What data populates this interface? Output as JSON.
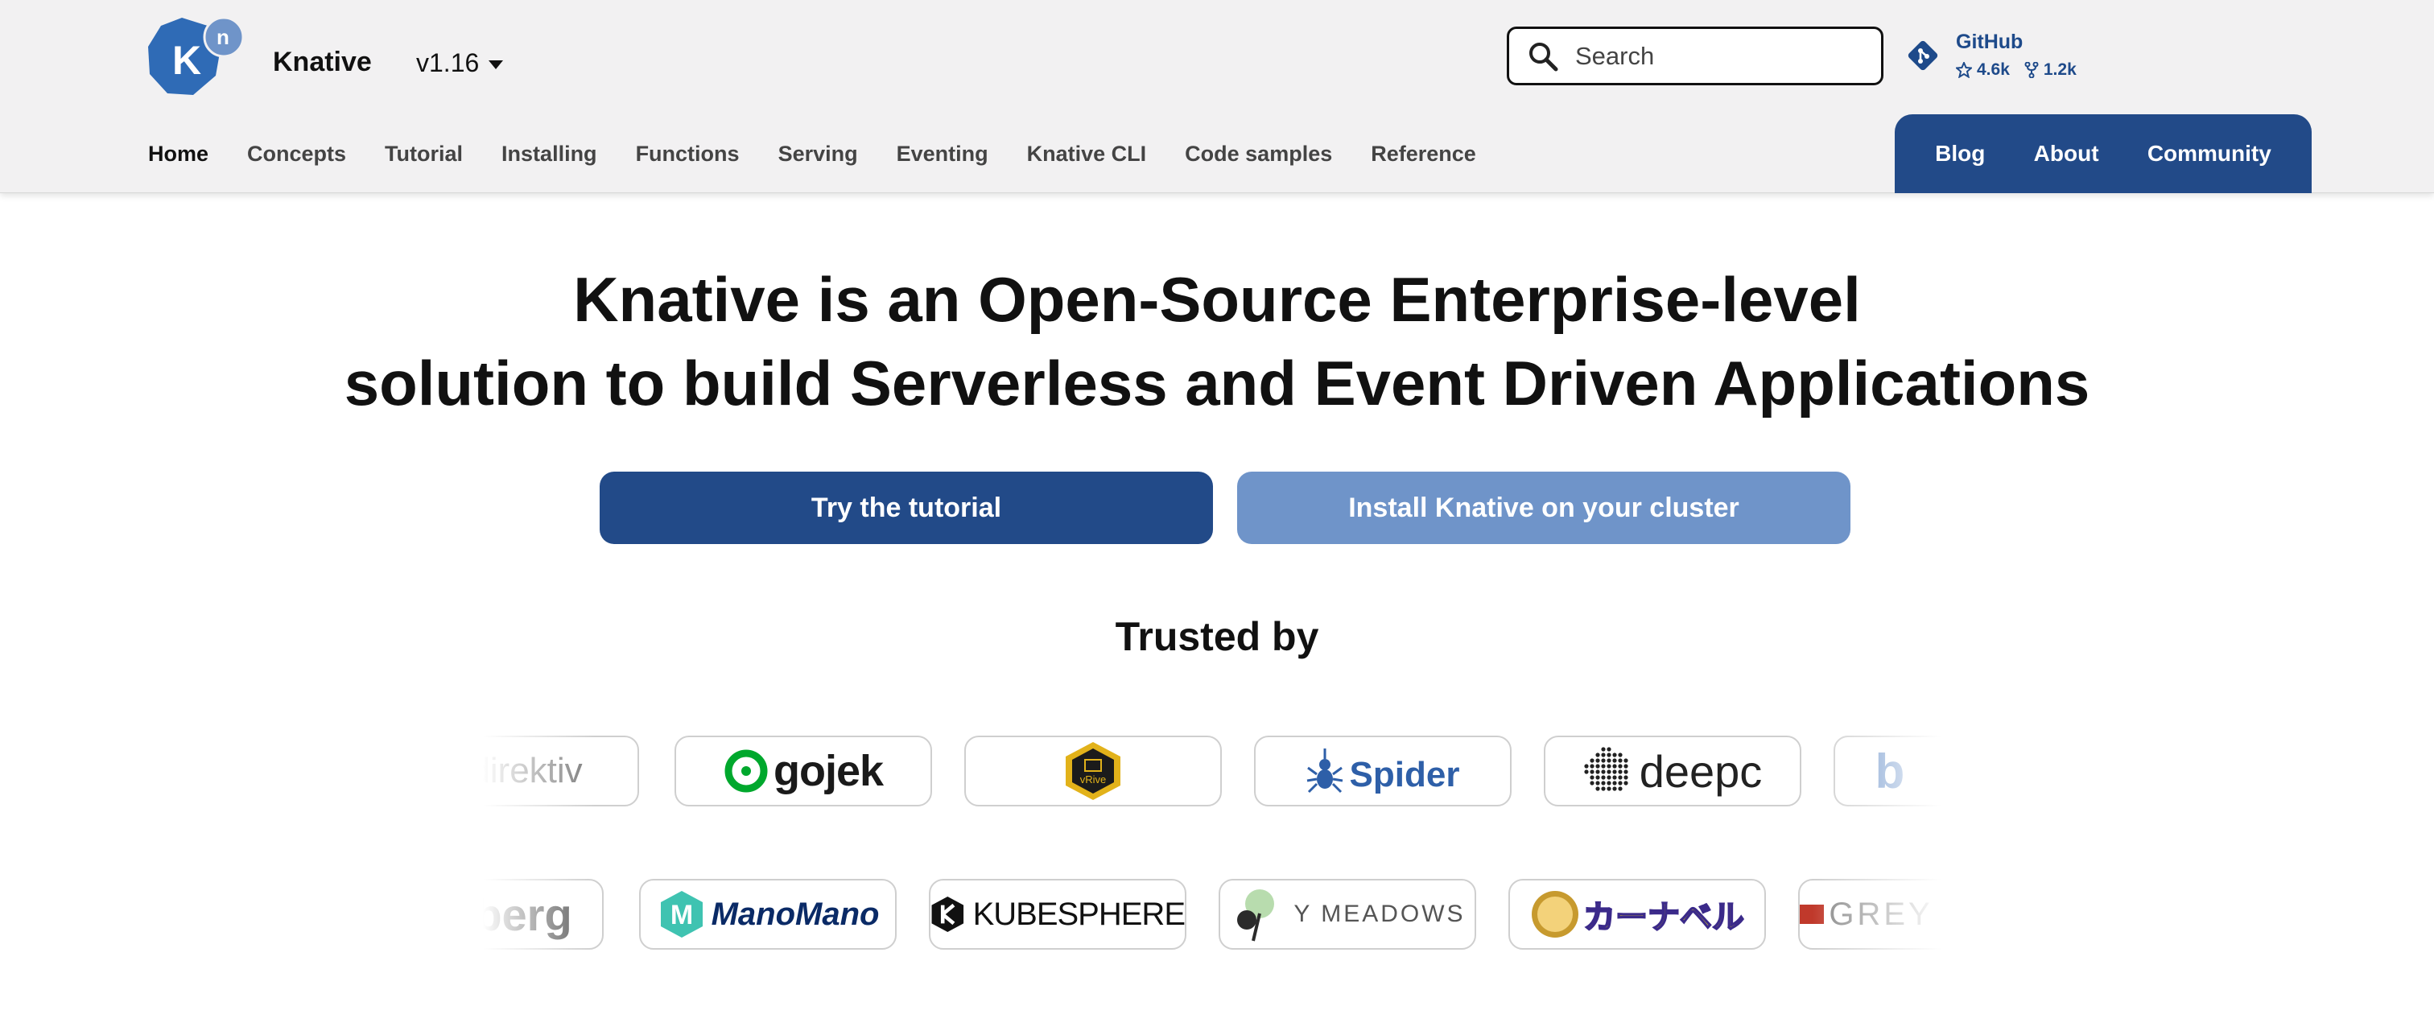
{
  "header": {
    "brand": "Knative",
    "logo_letter": "K",
    "logo_badge": "n",
    "version": "v1.16",
    "search_placeholder": "Search",
    "github": {
      "label": "GitHub",
      "stars": "4.6k",
      "forks": "1.2k"
    },
    "nav": [
      "Home",
      "Concepts",
      "Tutorial",
      "Installing",
      "Functions",
      "Serving",
      "Eventing",
      "Knative CLI",
      "Code samples",
      "Reference"
    ],
    "nav_active": "Home",
    "nav_right": [
      "Blog",
      "About",
      "Community"
    ]
  },
  "hero": {
    "title_line1": "Knative is an Open-Source Enterprise-level",
    "title_line2": "solution to build Serverless and Event Driven Applications",
    "primary_button": "Try the tutorial",
    "secondary_button": "Install Knative on your cluster"
  },
  "trusted": {
    "heading": "Trusted by",
    "row1": [
      "direktiv",
      "gojek",
      "vRive",
      "Spider",
      "deepc",
      "b"
    ],
    "row2": [
      "berg",
      "ManoMano",
      "KUBESPHERE",
      "Y MEADOWS",
      "カーナベル",
      "GREY"
    ]
  },
  "colors": {
    "brand_blue": "#224a88",
    "light_blue": "#6f94c9",
    "logo_blue": "#2f6bb6"
  }
}
